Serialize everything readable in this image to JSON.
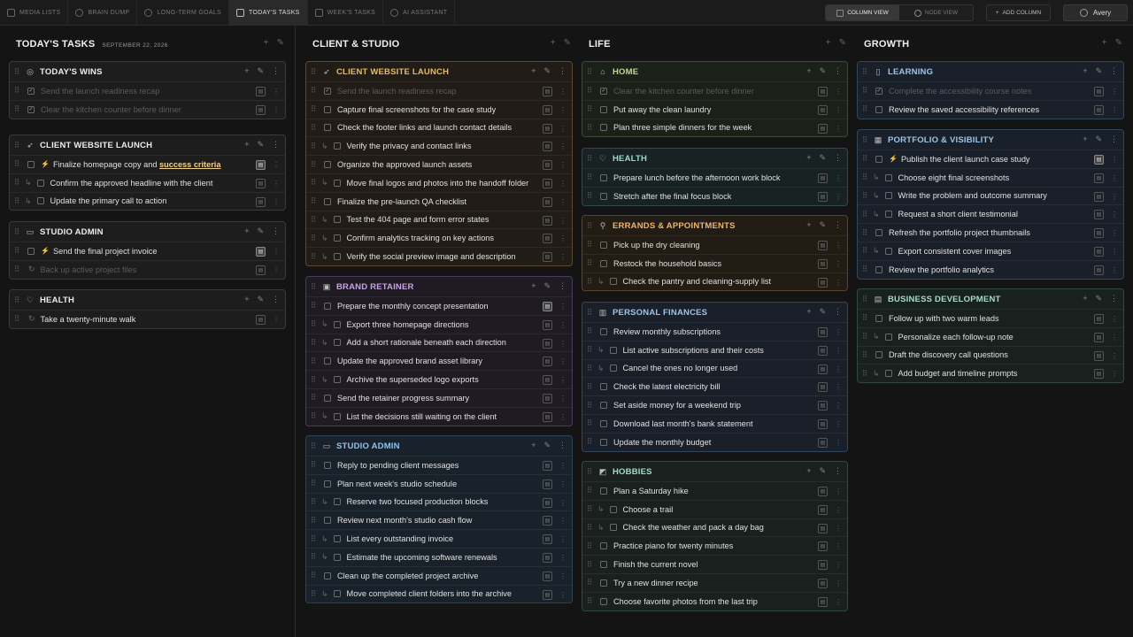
{
  "topbar": {
    "tabs": [
      {
        "label": "MEDIA LISTS",
        "icon": "star-icon"
      },
      {
        "label": "BRAIN DUMP",
        "icon": "brain-icon"
      },
      {
        "label": "LONG-TERM GOALS",
        "icon": "goal-icon"
      },
      {
        "label": "TODAY'S TASKS",
        "icon": "calendar-icon",
        "active": true
      },
      {
        "label": "WEEK'S TASKS",
        "icon": "calendar-week-icon"
      },
      {
        "label": "AI ASSISTANT",
        "icon": "sparkle-icon"
      }
    ],
    "view_column": "COLUMN VIEW",
    "view_node": "NODE VIEW",
    "add_column": "ADD COLUMN",
    "user": "Avery"
  },
  "columns": [
    {
      "title": "TODAY'S TASKS",
      "date": "SEPTEMBER 22, 2026",
      "groups": [
        {
          "title": "TODAY'S WINS",
          "icon": "trophy-icon",
          "color": "gray",
          "tasks": [
            {
              "text": "Send the launch readiness recap",
              "done": true
            },
            {
              "text": "Clear the kitchen counter before dinner",
              "done": true
            }
          ]
        },
        {
          "title": "CLIENT WEBSITE LAUNCH",
          "icon": "rocket-icon",
          "color": "gray",
          "tasks": [
            {
              "text": "Finalize homepage copy and ",
              "bold": "success criteria",
              "bolt": true,
              "hi": true
            },
            {
              "text": "Confirm the approved headline with the client",
              "sub": true
            },
            {
              "text": "Update the primary call to action",
              "sub": true
            }
          ]
        },
        {
          "title": "STUDIO ADMIN",
          "icon": "inbox-icon",
          "color": "gray",
          "tasks": [
            {
              "text": "Send the final project invoice",
              "bolt": true,
              "hi": true
            },
            {
              "text": "Back up active project files",
              "done": true,
              "recur": true
            }
          ]
        },
        {
          "title": "HEALTH",
          "icon": "heart-icon",
          "color": "gray",
          "tasks": [
            {
              "text": "Take a twenty-minute walk",
              "recur": true
            }
          ]
        }
      ]
    },
    {
      "title": "CLIENT & STUDIO",
      "groups": [
        {
          "title": "CLIENT WEBSITE LAUNCH",
          "icon": "rocket-icon",
          "color": "amber",
          "tasks": [
            {
              "text": "Send the launch readiness recap",
              "done": true
            },
            {
              "text": "Capture final screenshots for the case study"
            },
            {
              "text": "Check the footer links and launch contact details"
            },
            {
              "text": "Verify the privacy and contact links",
              "sub": true
            },
            {
              "text": "Organize the approved launch assets"
            },
            {
              "text": "Move final logos and photos into the handoff folder",
              "sub": true
            },
            {
              "text": "Finalize the pre-launch QA checklist"
            },
            {
              "text": "Test the 404 page and form error states",
              "sub": true
            },
            {
              "text": "Confirm analytics tracking on key actions",
              "sub": true
            },
            {
              "text": "Verify the social preview image and description",
              "sub": true
            }
          ]
        },
        {
          "title": "BRAND RETAINER",
          "icon": "frame-icon",
          "color": "purple",
          "tasks": [
            {
              "text": "Prepare the monthly concept presentation",
              "hi": true
            },
            {
              "text": "Export three homepage directions",
              "sub": true
            },
            {
              "text": "Add a short rationale beneath each direction",
              "sub": true
            },
            {
              "text": "Update the approved brand asset library"
            },
            {
              "text": "Archive the superseded logo exports",
              "sub": true
            },
            {
              "text": "Send the retainer progress summary"
            },
            {
              "text": "List the decisions still waiting on the client",
              "sub": true
            }
          ]
        },
        {
          "title": "STUDIO ADMIN",
          "icon": "inbox-icon",
          "color": "blue",
          "tasks": [
            {
              "text": "Reply to pending client messages"
            },
            {
              "text": "Plan next week's studio schedule"
            },
            {
              "text": "Reserve two focused production blocks",
              "sub": true
            },
            {
              "text": "Review next month's studio cash flow"
            },
            {
              "text": "List every outstanding invoice",
              "sub": true
            },
            {
              "text": "Estimate the upcoming software renewals",
              "sub": true
            },
            {
              "text": "Clean up the completed project archive"
            },
            {
              "text": "Move completed client folders into the archive",
              "sub": true
            }
          ]
        }
      ]
    },
    {
      "title": "LIFE",
      "groups": [
        {
          "title": "HOME",
          "icon": "home-icon",
          "color": "green",
          "tasks": [
            {
              "text": "Clear the kitchen counter before dinner",
              "done": true
            },
            {
              "text": "Put away the clean laundry"
            },
            {
              "text": "Plan three simple dinners for the week"
            }
          ]
        },
        {
          "title": "HEALTH",
          "icon": "heart-icon",
          "color": "teal",
          "tasks": [
            {
              "text": "Prepare lunch before the afternoon work block"
            },
            {
              "text": "Stretch after the final focus block"
            }
          ]
        },
        {
          "title": "ERRANDS & APPOINTMENTS",
          "icon": "pin-icon",
          "color": "orange",
          "tasks": [
            {
              "text": "Pick up the dry cleaning"
            },
            {
              "text": "Restock the household basics"
            },
            {
              "text": "Check the pantry and cleaning-supply list",
              "sub": true
            }
          ]
        },
        {
          "title": "PERSONAL FINANCES",
          "icon": "bank-icon",
          "color": "steel",
          "tasks": [
            {
              "text": "Review monthly subscriptions"
            },
            {
              "text": "List active subscriptions and their costs",
              "sub": true
            },
            {
              "text": "Cancel the ones no longer used",
              "sub": true
            },
            {
              "text": "Check the latest electricity bill"
            },
            {
              "text": "Set aside money for a weekend trip"
            },
            {
              "text": "Download last month's bank statement"
            },
            {
              "text": "Update the monthly budget"
            }
          ]
        },
        {
          "title": "HOBBIES",
          "icon": "palette-icon",
          "color": "seafoam",
          "tasks": [
            {
              "text": "Plan a Saturday hike"
            },
            {
              "text": "Choose a trail",
              "sub": true
            },
            {
              "text": "Check the weather and pack a day bag",
              "sub": true
            },
            {
              "text": "Practice piano for twenty minutes"
            },
            {
              "text": "Finish the current novel"
            },
            {
              "text": "Try a new dinner recipe"
            },
            {
              "text": "Choose favorite photos from the last trip"
            }
          ]
        }
      ]
    },
    {
      "title": "GROWTH",
      "groups": [
        {
          "title": "LEARNING",
          "icon": "book-icon",
          "color": "steel",
          "tasks": [
            {
              "text": "Complete the accessibility course notes",
              "done": true
            },
            {
              "text": "Review the saved accessibility references"
            }
          ]
        },
        {
          "title": "PORTFOLIO & VISIBILITY",
          "icon": "gallery-icon",
          "color": "steel",
          "tasks": [
            {
              "text": "Publish the client launch case study",
              "bolt": true,
              "hi": true
            },
            {
              "text": "Choose eight final screenshots",
              "sub": true
            },
            {
              "text": "Write the problem and outcome summary",
              "sub": true
            },
            {
              "text": "Request a short client testimonial",
              "sub": true
            },
            {
              "text": "Refresh the portfolio project thumbnails"
            },
            {
              "text": "Export consistent cover images",
              "sub": true
            },
            {
              "text": "Review the portfolio analytics"
            }
          ]
        },
        {
          "title": "BUSINESS DEVELOPMENT",
          "icon": "handshake-icon",
          "color": "seafoam",
          "tasks": [
            {
              "text": "Follow up with two warm leads"
            },
            {
              "text": "Personalize each follow-up note",
              "sub": true
            },
            {
              "text": "Draft the discovery call questions"
            },
            {
              "text": "Add budget and timeline prompts",
              "sub": true
            }
          ]
        }
      ]
    }
  ]
}
